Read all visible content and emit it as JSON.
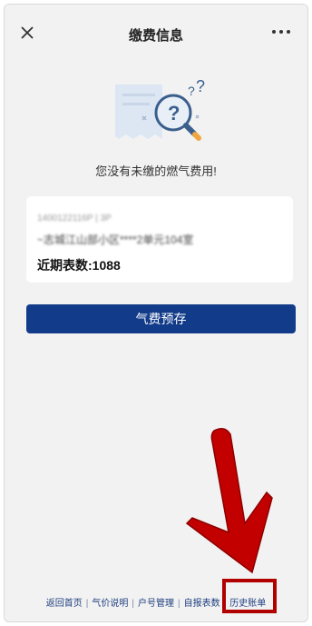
{
  "header": {
    "title": "缴费信息"
  },
  "empty_state": {
    "message": "您没有未缴的燃气费用!"
  },
  "account_card": {
    "account_id": "1400122116P | 3P",
    "address": "~志城江山部小区****2单元104室",
    "meter_reading_label": "近期表数:1088"
  },
  "actions": {
    "prestore_label": "气费预存"
  },
  "footer": {
    "links": [
      "返回首页",
      "气价说明",
      "户号管理",
      "自报表数",
      "历史账单"
    ],
    "separator": "|"
  },
  "colors": {
    "primary_button": "#123b8a",
    "highlight": "#b00000",
    "background": "#f2f2f2"
  }
}
